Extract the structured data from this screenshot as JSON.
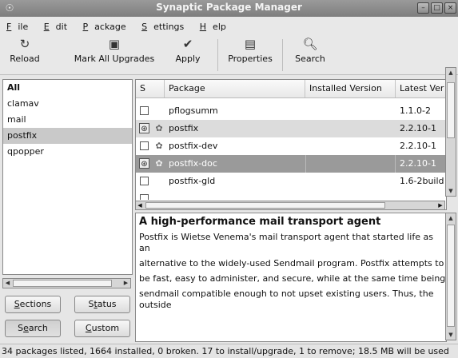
{
  "window": {
    "title": "Synaptic Package Manager",
    "buttons": {
      "minimize": "–",
      "maximize": "□",
      "close": "×"
    }
  },
  "menubar": [
    {
      "accel": "F",
      "rest": "ile"
    },
    {
      "accel": "E",
      "rest": "dit"
    },
    {
      "accel": "P",
      "rest": "ackage"
    },
    {
      "pre": "",
      "accel": "S",
      "rest": "ettings"
    },
    {
      "accel": "H",
      "rest": "elp"
    }
  ],
  "toolbar": {
    "reload": "Reload",
    "mark_all": "Mark All Upgrades",
    "apply": "Apply",
    "properties": "Properties",
    "search": "Search"
  },
  "filters": {
    "items": [
      "All",
      "clamav",
      "mail",
      "postfix",
      "qpopper"
    ],
    "selected": "postfix"
  },
  "filter_buttons": {
    "sections": {
      "accel": "S",
      "rest": "ections"
    },
    "status": {
      "pre": "S",
      "accel": "t",
      "rest": "atus"
    },
    "search": {
      "pre": "S",
      "accel": "e",
      "rest": "arch"
    },
    "custom": {
      "accel": "C",
      "rest": "ustom"
    }
  },
  "table": {
    "columns": {
      "s": "S",
      "package": "Package",
      "installed": "Installed Version",
      "latest": "Latest Ver"
    },
    "rows": [
      {
        "name": "pflogsumm",
        "installed": "",
        "latest": "1.1.0-2"
      },
      {
        "name": "postfix",
        "installed": "",
        "latest": "2.2.10-1"
      },
      {
        "name": "postfix-dev",
        "installed": "",
        "latest": "2.2.10-1"
      },
      {
        "name": "postfix-doc",
        "installed": "",
        "latest": "2.2.10-1"
      },
      {
        "name": "postfix-gld",
        "installed": "",
        "latest": "1.6-2build"
      }
    ]
  },
  "description": {
    "title": "A high-performance mail transport agent",
    "lines": [
      "Postfix is Wietse Venema's mail transport agent that started life as an",
      "alternative to the widely-used Sendmail program.  Postfix attempts to",
      "be fast, easy to administer, and secure, while at the same time being",
      "sendmail compatible enough to not upset existing users. Thus, the outside"
    ]
  },
  "status": "34 packages listed, 1664 installed, 0 broken. 17 to install/upgrade, 1 to remove; 18.5 MB will be used"
}
